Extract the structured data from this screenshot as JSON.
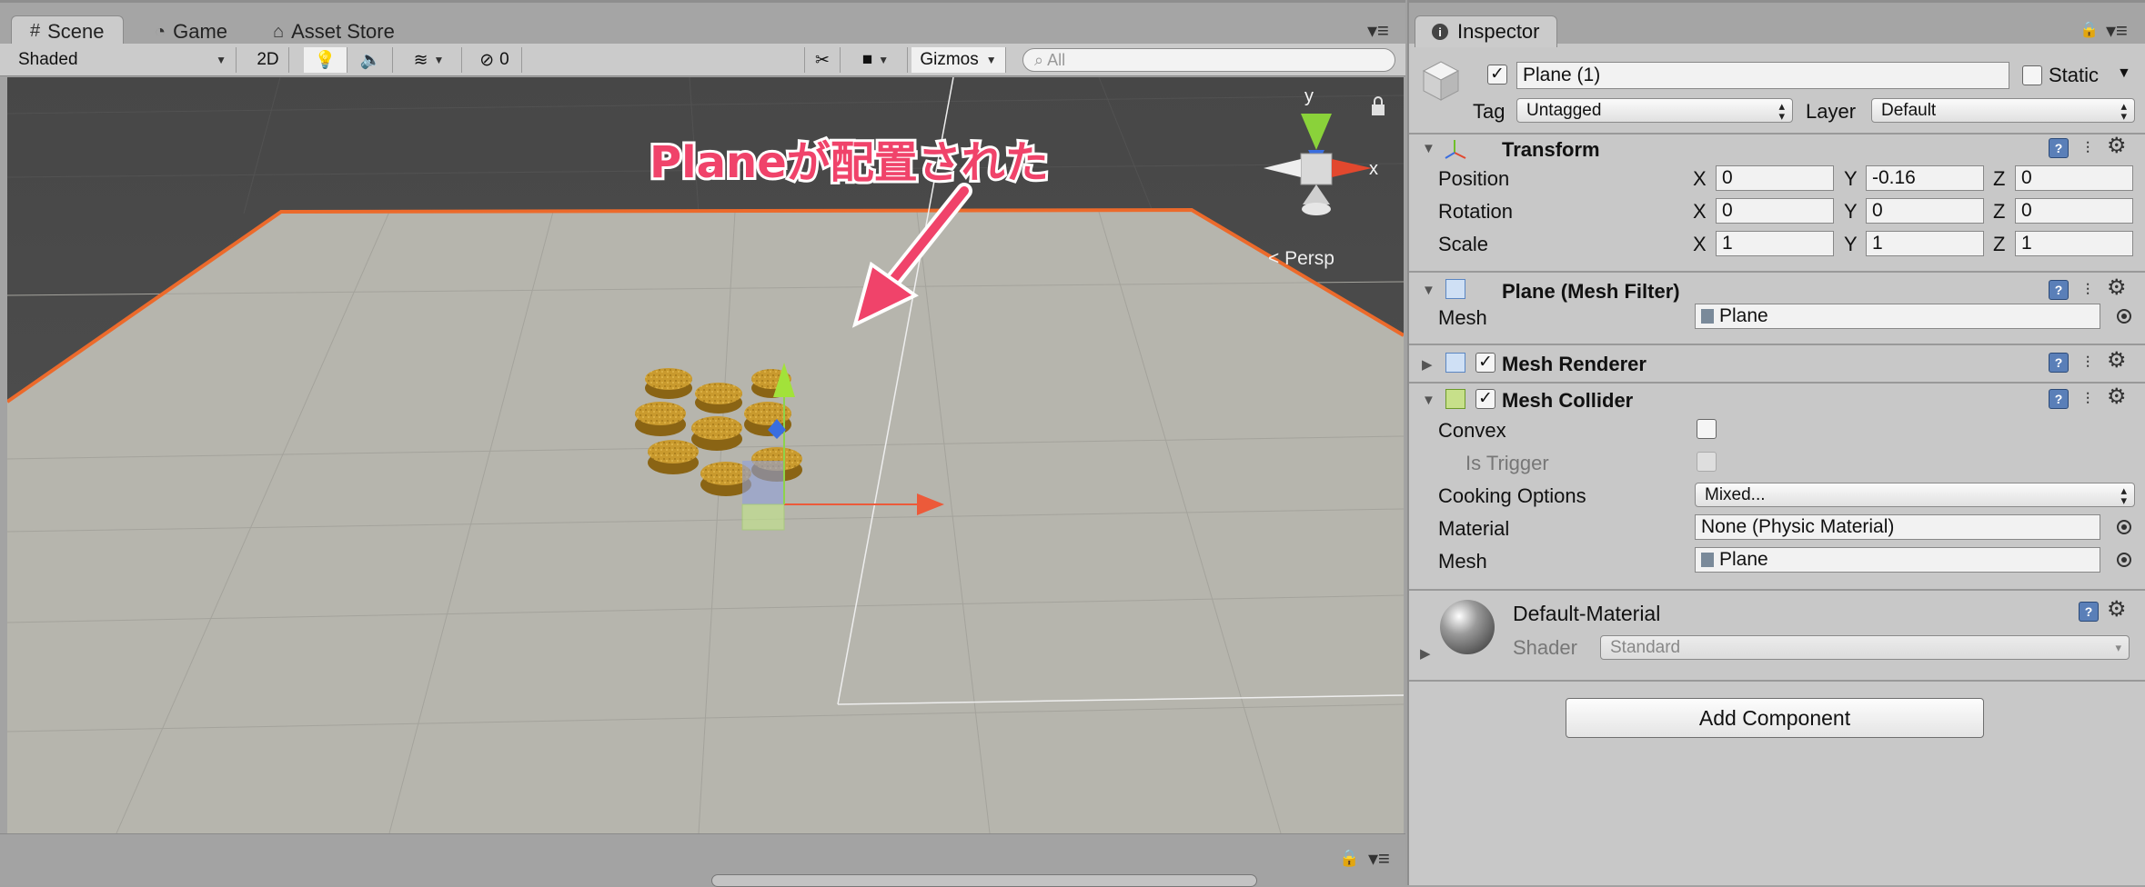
{
  "scene": {
    "tabs": [
      {
        "label": "Scene",
        "icon": "grid-icon"
      },
      {
        "label": "Game",
        "icon": "pacman-icon"
      },
      {
        "label": "Asset Store",
        "icon": "store-icon"
      }
    ],
    "toolbar": {
      "draw_mode": "Shaded",
      "mode_2d": "2D",
      "hidden_count": "0",
      "gizmos": "Gizmos",
      "search_placeholder": "All"
    },
    "view": {
      "axis_y": "y",
      "axis_x": "x",
      "projection": "< Persp",
      "annotation": "Planeが配置された",
      "annotation_color": "#f0436a",
      "selection_color": "#ec6a2b"
    }
  },
  "inspector": {
    "tab_label": "Inspector",
    "object": {
      "active": true,
      "name": "Plane (1)",
      "static_label": "Static",
      "tag_label": "Tag",
      "tag_value": "Untagged",
      "layer_label": "Layer",
      "layer_value": "Default"
    },
    "transform": {
      "title": "Transform",
      "rows": [
        {
          "label": "Position",
          "x": "0",
          "y": "-0.16",
          "z": "0"
        },
        {
          "label": "Rotation",
          "x": "0",
          "y": "0",
          "z": "0"
        },
        {
          "label": "Scale",
          "x": "1",
          "y": "1",
          "z": "1"
        }
      ],
      "axis_x": "X",
      "axis_y": "Y",
      "axis_z": "Z"
    },
    "mesh_filter": {
      "title": "Plane (Mesh Filter)",
      "mesh_label": "Mesh",
      "mesh_value": "Plane"
    },
    "mesh_renderer": {
      "title": "Mesh Renderer",
      "enabled": true
    },
    "mesh_collider": {
      "title": "Mesh Collider",
      "enabled": true,
      "convex_label": "Convex",
      "is_trigger_label": "Is Trigger",
      "cooking_label": "Cooking Options",
      "cooking_value": "Mixed...",
      "material_label": "Material",
      "material_value": "None (Physic Material)",
      "mesh_label": "Mesh",
      "mesh_value": "Plane"
    },
    "material": {
      "name": "Default-Material",
      "shader_label": "Shader",
      "shader_value": "Standard"
    },
    "add_component": "Add Component"
  }
}
